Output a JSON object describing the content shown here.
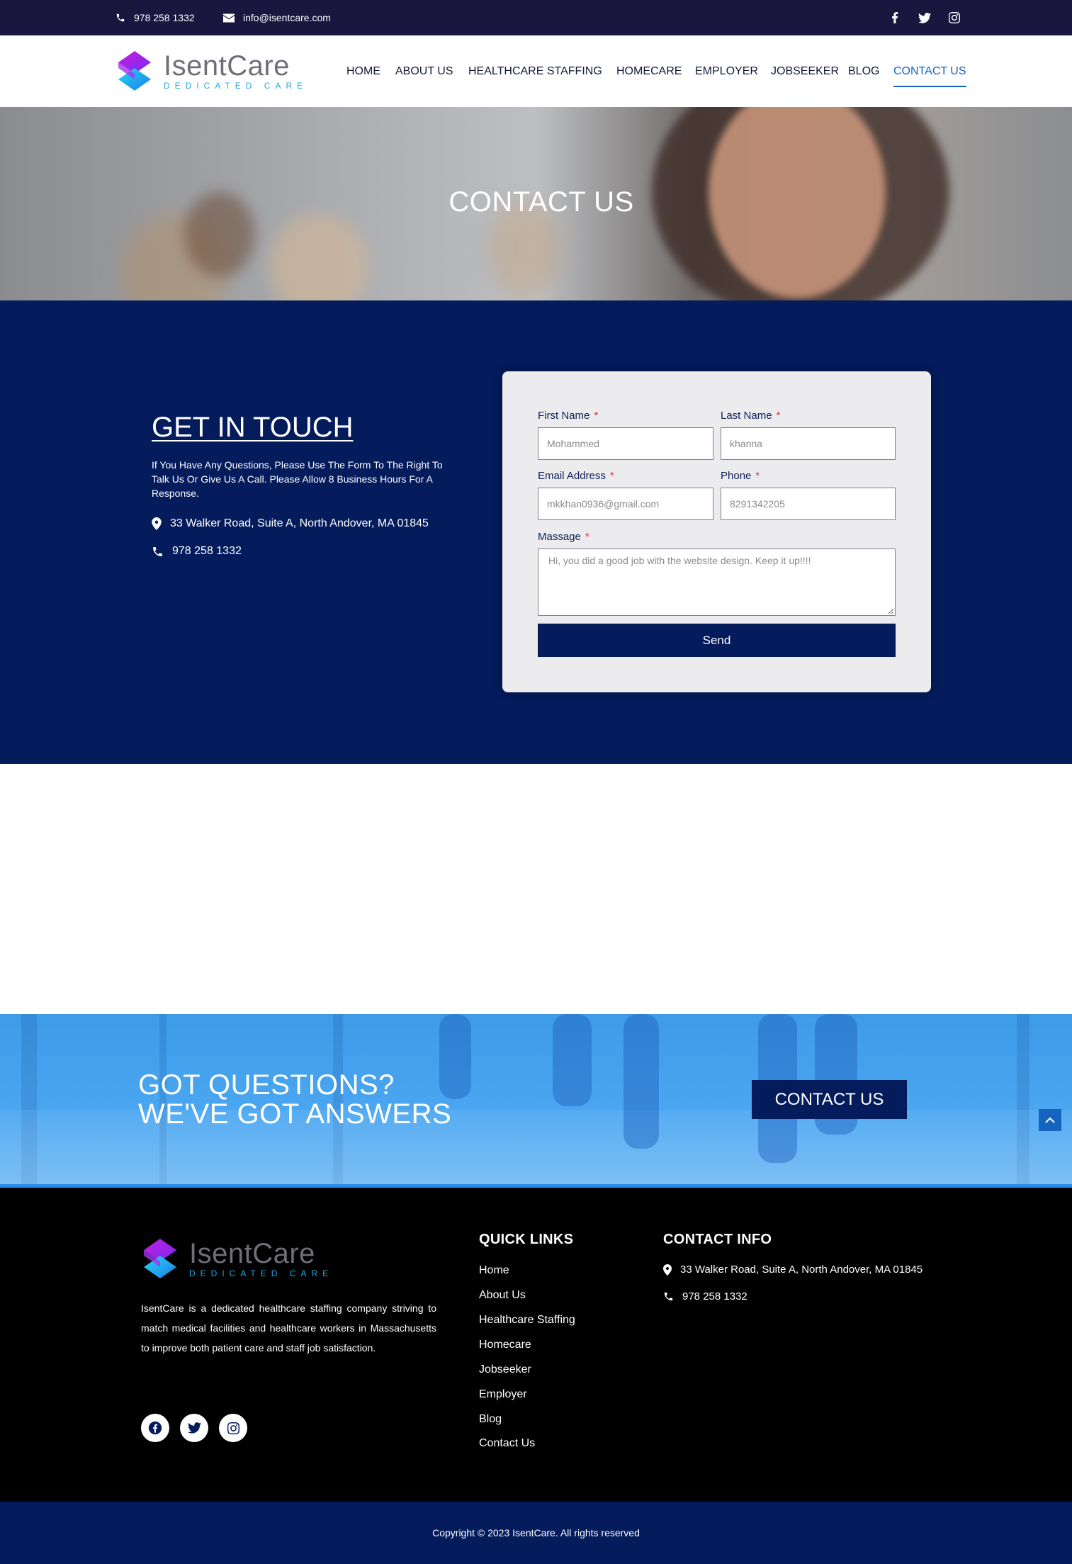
{
  "topbar": {
    "phone": "978 258 1332",
    "email": "info@isentcare.com",
    "social_icons": [
      "facebook-icon",
      "twitter-icon",
      "instagram-icon"
    ]
  },
  "brand": {
    "name": "IsentCare",
    "tagline": "DEDICATED CARE",
    "colors": {
      "navy": "#041b5c",
      "topbar": "#19173f",
      "accent_blue": "#1565c0",
      "cta_blue": "#4aa6f0"
    }
  },
  "nav": {
    "items": [
      {
        "label": "HOME"
      },
      {
        "label": "ABOUT US"
      },
      {
        "label": "HEALTHCARE STAFFING"
      },
      {
        "label": "HOMECARE"
      },
      {
        "label": "EMPLOYER"
      },
      {
        "label": "JOBSEEKER"
      },
      {
        "label": "BLOG"
      },
      {
        "label": "CONTACT US",
        "active": true
      }
    ]
  },
  "hero": {
    "title": "CONTACT US"
  },
  "get_in_touch": {
    "title": "GET IN TOUCH",
    "description": "If You Have Any Questions, Please Use The Form To The Right To Talk Us Or Give Us A Call. Please Allow 8 Business Hours For A Response.",
    "address": "33 Walker Road, Suite A, North Andover, MA 01845",
    "phone": "978 258 1332"
  },
  "form": {
    "first_name": {
      "label": "First Name",
      "required": "*",
      "value": "Mohammed"
    },
    "last_name": {
      "label": "Last Name",
      "required": "*",
      "value": "khanna"
    },
    "email": {
      "label": "Email Address",
      "required": "*",
      "value": "mkkhan0936@gmail.com"
    },
    "phone": {
      "label": "Phone",
      "required": "*",
      "value": "8291342205"
    },
    "message": {
      "label": "Massage",
      "required": "*",
      "value": "Hi, you did a good job with the website design. Keep it up!!!!"
    },
    "submit_label": "Send"
  },
  "cta": {
    "line1": "GOT QUESTIONS?",
    "line2": "WE'VE GOT ANSWERS",
    "button_label": "CONTACT US"
  },
  "footer": {
    "about": "IsentCare is a dedicated healthcare staffing company striving to match medical facilities and healthcare workers in Massachusetts to improve both patient care and staff job satisfaction.",
    "quick_links_title": "QUICK LINKS",
    "quick_links": [
      "Home",
      "About Us",
      "Healthcare Staffing",
      "Homecare",
      "Jobseeker",
      "Employer",
      "Blog",
      "Contact Us"
    ],
    "contact_info_title": "CONTACT INFO",
    "address": "33 Walker Road, Suite A, North Andover, MA 01845",
    "phone": "978 258 1332",
    "social_icons": [
      "facebook-icon",
      "twitter-icon",
      "instagram-icon"
    ]
  },
  "copyright": "Copyright © 2023 IsentCare. All rights reserved"
}
